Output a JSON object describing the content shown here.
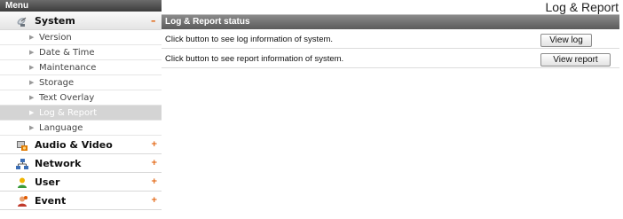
{
  "sidebar": {
    "title": "Menu",
    "system": {
      "label": "System",
      "toggle": "–",
      "items": [
        {
          "label": "Version"
        },
        {
          "label": "Date & Time"
        },
        {
          "label": "Maintenance"
        },
        {
          "label": "Storage"
        },
        {
          "label": "Text Overlay"
        },
        {
          "label": "Log & Report"
        },
        {
          "label": "Language"
        }
      ],
      "active_item": "Log & Report"
    },
    "categories": [
      {
        "label": "Audio & Video",
        "toggle": "+",
        "icon": "camera-film-icon"
      },
      {
        "label": "Network",
        "toggle": "+",
        "icon": "network-icon"
      },
      {
        "label": "User",
        "toggle": "+",
        "icon": "user-icon"
      },
      {
        "label": "Event",
        "toggle": "+",
        "icon": "event-icon"
      }
    ]
  },
  "main": {
    "page_title": "Log & Report",
    "section_title": "Log & Report status",
    "rows": [
      {
        "text": "Click button to see log information of system.",
        "button": "View log"
      },
      {
        "text": "Click button to see report information of system.",
        "button": "View report"
      }
    ]
  },
  "colors": {
    "header_dark": "#4a4a4a",
    "section_header": "#6e6e6e",
    "active_item": "#d4d4d4",
    "toggle_accent": "#e05a00"
  }
}
